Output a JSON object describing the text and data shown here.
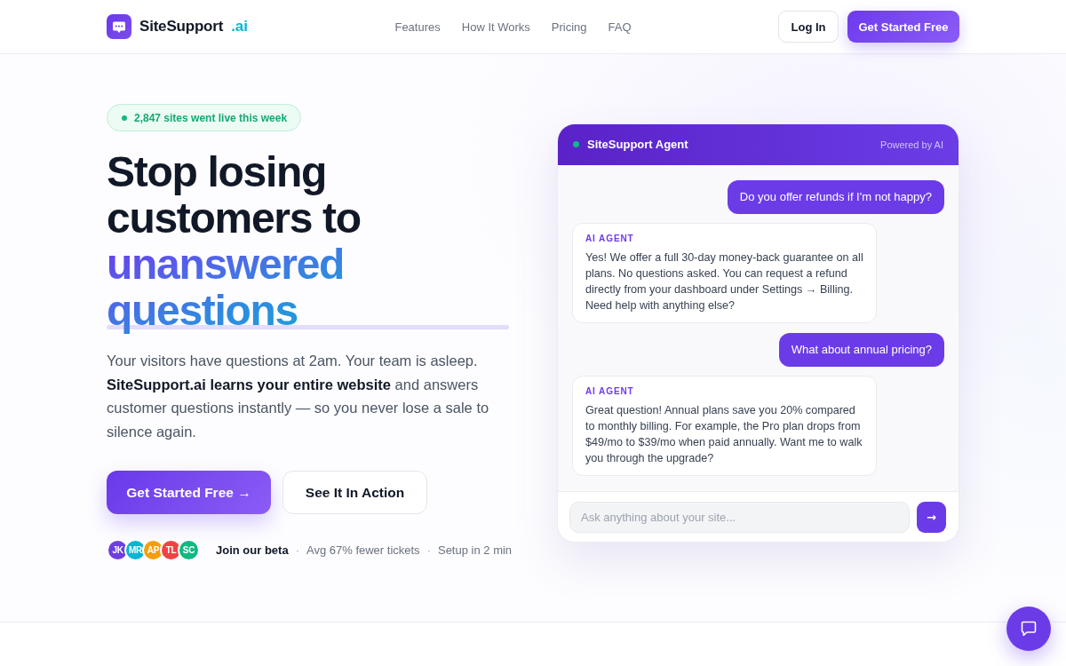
{
  "nav": {
    "brand": "SiteSupport",
    "brand_suffix": ".ai",
    "links": [
      "Features",
      "How It Works",
      "Pricing",
      "FAQ"
    ],
    "actions": [
      {
        "label": "Log In",
        "kind": "outline"
      },
      {
        "label": "Get Started Free",
        "kind": "primary"
      }
    ]
  },
  "hero": {
    "badge": "2,847 sites went live this week",
    "headline": "Stop losing customers to",
    "headline_highlight": "unanswered questions",
    "description": "Your visitors have questions at 2am. Your team is asleep. **SiteSupport.ai learns your entire website** and answers customer questions instantly — so you never lose a sale to silence again.",
    "buttons": [
      {
        "label": "Get Started Free →",
        "kind": "primary"
      },
      {
        "label": "See It In Action",
        "kind": "outline"
      }
    ],
    "avatars": [
      {
        "initials": "JK",
        "color": "#6d3fe0"
      },
      {
        "initials": "MR",
        "color": "#06b6d4"
      },
      {
        "initials": "AP",
        "color": "#f59e0b"
      },
      {
        "initials": "TL",
        "color": "#ef4444"
      },
      {
        "initials": "SC",
        "color": "#10b981"
      }
    ],
    "proof": [
      {
        "text": "Join our beta",
        "kind": "strong"
      },
      {
        "text": "·",
        "kind": "separator"
      },
      {
        "text": "Avg 67% fewer tickets",
        "kind": "plain"
      },
      {
        "text": "·",
        "kind": "separator"
      },
      {
        "text": "Setup in 2 min",
        "kind": "plain"
      }
    ]
  },
  "chat": {
    "online": true,
    "title": "SiteSupport Agent",
    "subtitle": "Powered by AI",
    "messages": [
      {
        "kind": "user",
        "text": "Do you offer refunds if I'm not happy?"
      },
      {
        "kind": "agent",
        "label": "AI AGENT",
        "text": "Yes! We offer a full 30-day money-back guarantee on all plans. No questions asked. You can request a refund directly from your dashboard under Settings → Billing. Need help with anything else?"
      },
      {
        "kind": "user",
        "text": "What about annual pricing?"
      },
      {
        "kind": "agent",
        "label": "AI AGENT",
        "text": "Great question! Annual plans save you 20% compared to monthly billing. For example, the Pro plan drops from $49/mo to $39/mo when paid annually. Want me to walk you through the upgrade?"
      }
    ],
    "input": {
      "placeholder": "Ask anything about your site..."
    },
    "send_label": "→"
  }
}
